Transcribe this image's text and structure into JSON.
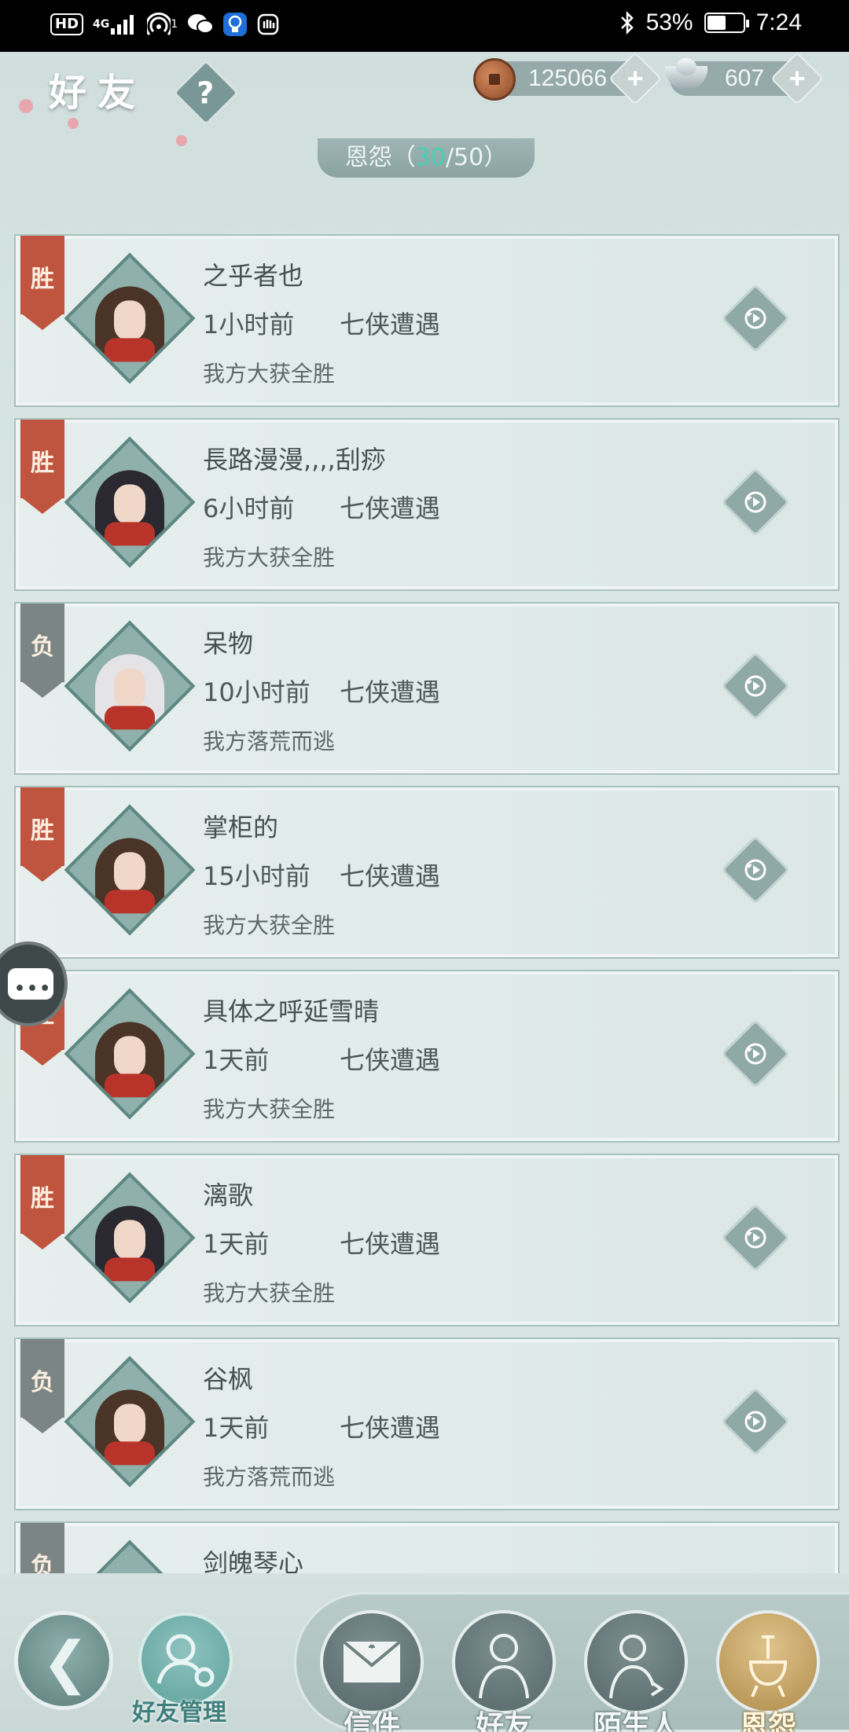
{
  "status_bar": {
    "left_icons": [
      "hd-icon",
      "signal-4g-icon",
      "hotspot-icon",
      "wechat-icon",
      "bulb-app-icon",
      "hand-app-icon"
    ],
    "hd": "HD",
    "net": "4G",
    "hotspot_sup": "1",
    "battery_text": "53%",
    "battery_level": 0.53,
    "time": "7:24"
  },
  "header": {
    "title": "好友",
    "help": "?",
    "copper": "125066",
    "silver": "607",
    "plus": "+",
    "section_label": "恩怨",
    "section_open": "（",
    "section_count": "30",
    "section_sep": "/50",
    "section_close": "）"
  },
  "records": [
    {
      "flag": "胜",
      "type": "win",
      "name": "之乎者也",
      "time": "1小时前",
      "mode": "七侠遭遇",
      "result": "我方大获全胜",
      "hair": "#4a3428"
    },
    {
      "flag": "胜",
      "type": "win",
      "name": "長路漫漫,,,,刮痧",
      "time": "6小时前",
      "mode": "七侠遭遇",
      "result": "我方大获全胜",
      "hair": "#2a2830"
    },
    {
      "flag": "负",
      "type": "lose",
      "name": "呆物",
      "time": "10小时前",
      "mode": "七侠遭遇",
      "result": "我方落荒而逃",
      "hair": "#e4e4e6"
    },
    {
      "flag": "胜",
      "type": "win",
      "name": "掌柜的",
      "time": "15小时前",
      "mode": "七侠遭遇",
      "result": "我方大获全胜",
      "hair": "#4a3428"
    },
    {
      "flag": "胜",
      "type": "win",
      "name": "具体之呼延雪晴",
      "time": "1天前",
      "mode": "七侠遭遇",
      "result": "我方大获全胜",
      "hair": "#4a3428"
    },
    {
      "flag": "胜",
      "type": "win",
      "name": "漓歌",
      "time": "1天前",
      "mode": "七侠遭遇",
      "result": "我方大获全胜",
      "hair": "#2a2830"
    },
    {
      "flag": "负",
      "type": "lose",
      "name": "谷枫",
      "time": "1天前",
      "mode": "七侠遭遇",
      "result": "我方落荒而逃",
      "hair": "#4a3428"
    },
    {
      "flag": "负",
      "type": "lose",
      "name": "剑魄琴心",
      "time": "",
      "mode": "",
      "result": "",
      "hair": "#2a2830"
    }
  ],
  "bottom_nav": {
    "back_glyph": "❮",
    "manage_label": "好友管理",
    "tabs": [
      {
        "label": "信件",
        "icon": "envelope-icon",
        "active": false
      },
      {
        "label": "好友",
        "icon": "friend-figure-icon",
        "active": false
      },
      {
        "label": "陌生人",
        "icon": "stranger-figure-icon",
        "active": false
      },
      {
        "label": "恩怨",
        "icon": "incense-burner-icon",
        "active": true
      }
    ]
  },
  "colors": {
    "win_flag": "#c0553f",
    "lose_flag": "#7b8583",
    "count_highlight": "#44d1b5",
    "card_border": "#a9c1be"
  }
}
